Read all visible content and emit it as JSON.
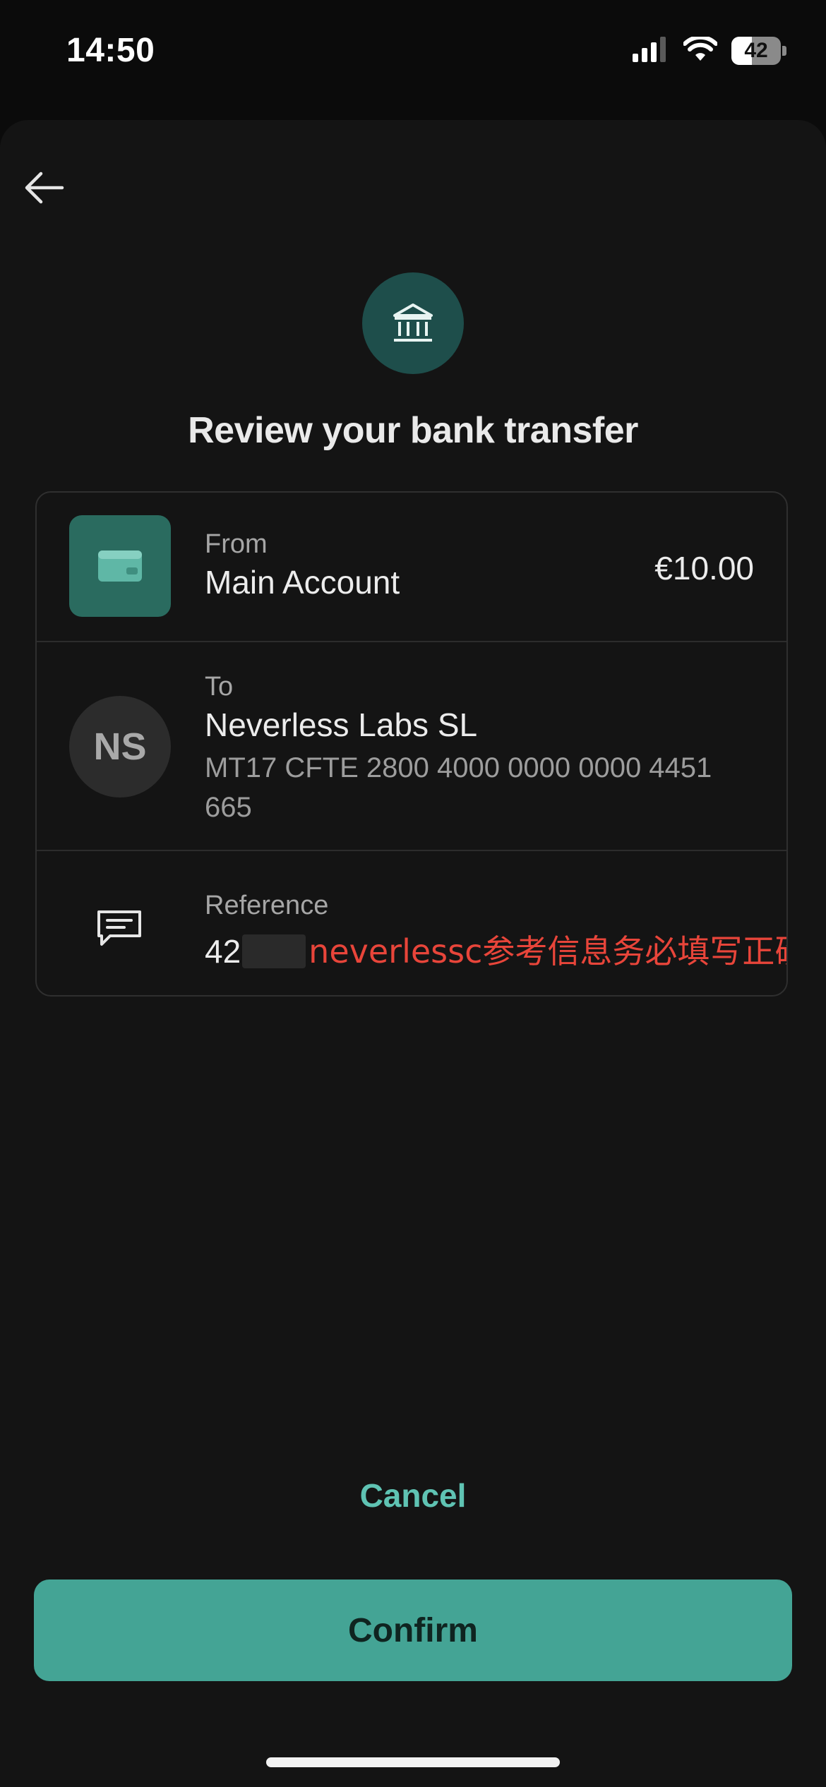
{
  "status_bar": {
    "time": "14:50",
    "battery": "42",
    "battery_level_percent": 42,
    "icons": [
      "signal-icon",
      "wifi-icon",
      "battery-icon"
    ]
  },
  "header": {
    "back_icon": "arrow-left-icon",
    "bank_icon": "bank-icon",
    "title": "Review your bank transfer"
  },
  "transfer": {
    "from": {
      "label": "From",
      "account": "Main Account",
      "amount": "€10.00",
      "icon": "wallet-icon"
    },
    "to": {
      "label": "To",
      "initials": "NS",
      "name": "Neverless Labs SL",
      "iban": "MT17 CFTE 2800 4000 0000 0000 4451 665"
    },
    "reference": {
      "label": "Reference",
      "value_prefix": "42",
      "note": "neverlessc参考信息务必填写正确",
      "icon": "message-icon"
    }
  },
  "actions": {
    "cancel_label": "Cancel",
    "confirm_label": "Confirm"
  },
  "colors": {
    "accent": "#44a495",
    "accent_text": "#5fc3b3",
    "note_red": "#e8453a",
    "badge_bg": "#1e4e4b"
  }
}
